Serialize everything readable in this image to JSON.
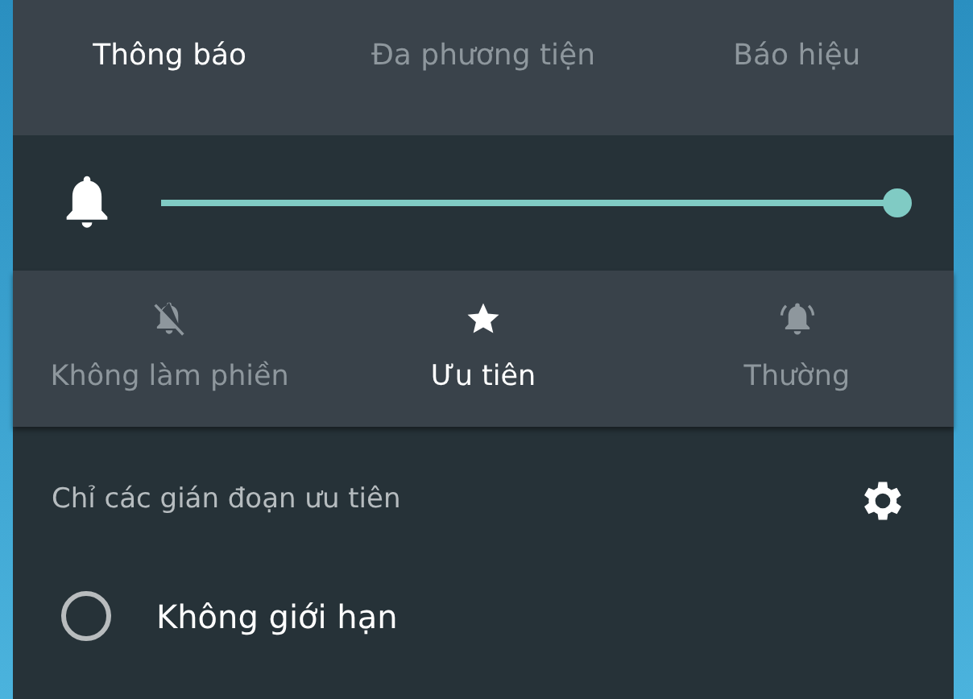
{
  "tabs": [
    {
      "label": "Thông báo",
      "selected": true
    },
    {
      "label": "Đa phương tiện",
      "selected": false
    },
    {
      "label": "Báo hiệu",
      "selected": false
    }
  ],
  "volume": {
    "level": 1.0
  },
  "modes": [
    {
      "kind": "none",
      "label": "Không làm phiền",
      "selected": false
    },
    {
      "kind": "priority",
      "label": "Ưu tiên",
      "selected": true
    },
    {
      "kind": "all",
      "label": "Thường",
      "selected": false
    }
  ],
  "priority_header": {
    "title": "Chỉ các gián đoạn ưu tiên"
  },
  "options": [
    {
      "label": "Không giới hạn",
      "checked": false
    }
  ]
}
